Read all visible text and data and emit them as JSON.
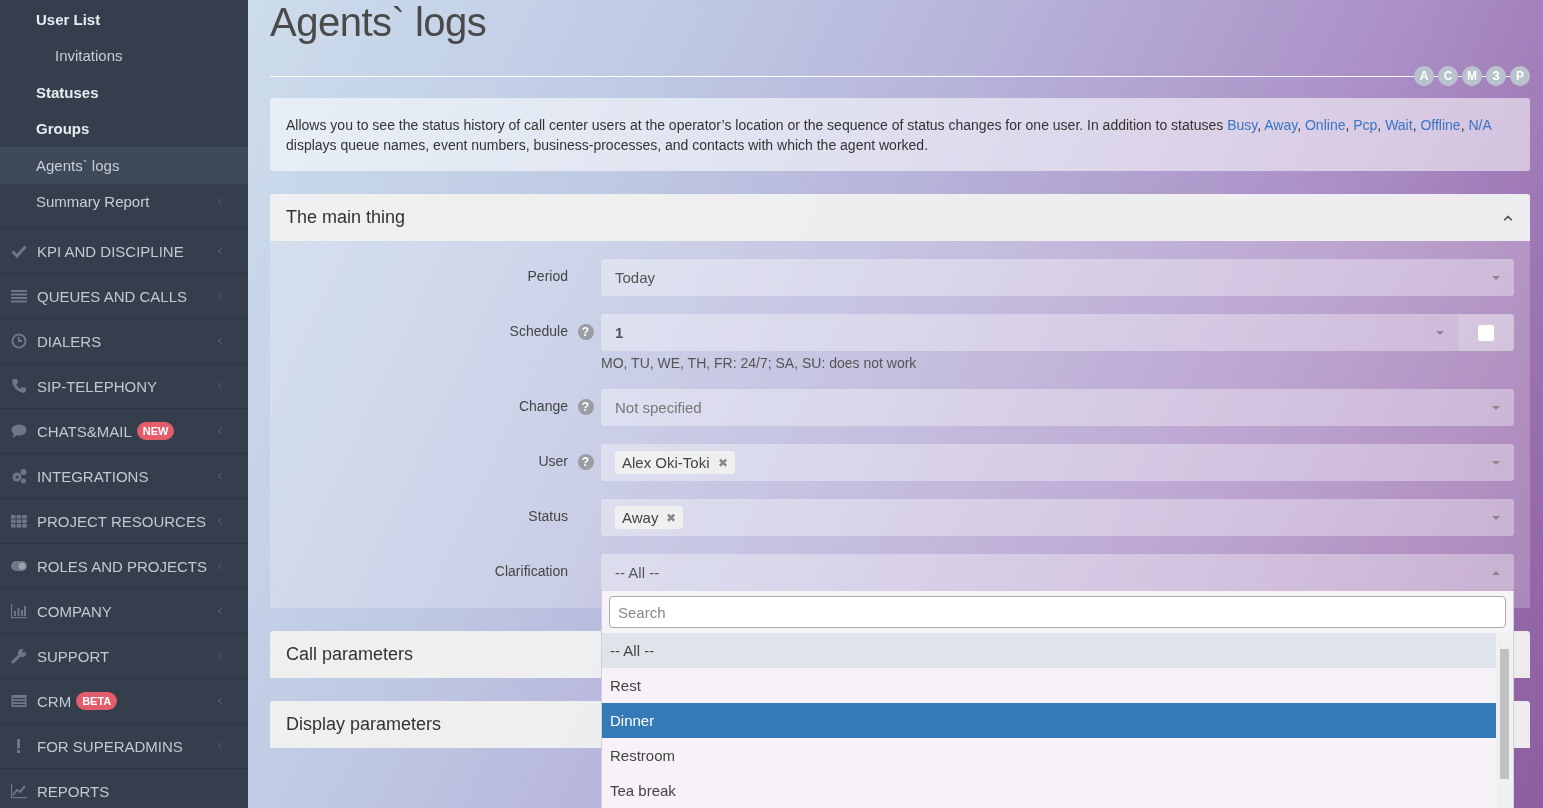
{
  "sidebar": {
    "items": [
      {
        "label": "User List",
        "kind": "link",
        "bold": true,
        "selected": false,
        "has_submenu": false
      },
      {
        "label": "Invitations",
        "kind": "nested",
        "bold": false,
        "selected": false,
        "has_submenu": false
      },
      {
        "label": "Statuses",
        "kind": "link",
        "bold": true,
        "selected": false,
        "has_submenu": false
      },
      {
        "label": "Groups",
        "kind": "link",
        "bold": true,
        "selected": false,
        "has_submenu": false
      },
      {
        "label": "Agents` logs",
        "kind": "link",
        "bold": false,
        "selected": true,
        "has_submenu": false
      },
      {
        "label": "Summary Report",
        "kind": "link",
        "bold": false,
        "selected": false,
        "has_submenu": true
      },
      {
        "label": "KPI AND DISCIPLINE",
        "kind": "section",
        "bold": false,
        "selected": false,
        "has_submenu": true
      },
      {
        "label": "QUEUES AND CALLS",
        "kind": "section",
        "bold": false,
        "selected": false,
        "has_submenu": true
      },
      {
        "label": "DIALERS",
        "kind": "section",
        "bold": false,
        "selected": false,
        "has_submenu": true
      },
      {
        "label": "SIP-TELEPHONY",
        "kind": "section",
        "bold": false,
        "selected": false,
        "has_submenu": true
      },
      {
        "label": "CHATS&MAIL",
        "kind": "section",
        "badge": "NEW",
        "bold": false,
        "selected": false,
        "has_submenu": true
      },
      {
        "label": "INTEGRATIONS",
        "kind": "section",
        "bold": false,
        "selected": false,
        "has_submenu": true
      },
      {
        "label": "PROJECT RESOURCES",
        "kind": "section",
        "bold": false,
        "selected": false,
        "has_submenu": true
      },
      {
        "label": "ROLES AND PROJECTS",
        "kind": "section",
        "bold": false,
        "selected": false,
        "has_submenu": true
      },
      {
        "label": "COMPANY",
        "kind": "section",
        "bold": false,
        "selected": false,
        "has_submenu": true
      },
      {
        "label": "SUPPORT",
        "kind": "section",
        "bold": false,
        "selected": false,
        "has_submenu": true
      },
      {
        "label": "CRM",
        "kind": "section",
        "badge": "BETA",
        "bold": false,
        "selected": false,
        "has_submenu": true
      },
      {
        "label": "FOR SUPERADMINS",
        "kind": "section",
        "bold": false,
        "selected": false,
        "has_submenu": true
      },
      {
        "label": "REPORTS",
        "kind": "section",
        "bold": false,
        "selected": false,
        "has_submenu": false
      }
    ]
  },
  "page": {
    "title": "Agents` logs",
    "steps": [
      "A",
      "C",
      "M",
      "З",
      "P"
    ]
  },
  "info": {
    "segments": [
      {
        "text": "Allows you to see the status history of call center users at the operator’s location or the sequence of status changes for one user. In addition to statuses ",
        "kind": "text"
      },
      {
        "text": "Busy",
        "kind": "link"
      },
      {
        "text": ", ",
        "kind": "text"
      },
      {
        "text": "Away",
        "kind": "link"
      },
      {
        "text": ", ",
        "kind": "text"
      },
      {
        "text": "Online",
        "kind": "link"
      },
      {
        "text": ", ",
        "kind": "text"
      },
      {
        "text": "Pcp",
        "kind": "link"
      },
      {
        "text": ", ",
        "kind": "text"
      },
      {
        "text": "Wait",
        "kind": "link"
      },
      {
        "text": ", ",
        "kind": "text"
      },
      {
        "text": "Offline",
        "kind": "link"
      },
      {
        "text": ", ",
        "kind": "text"
      },
      {
        "text": "N/A",
        "kind": "link"
      },
      {
        "text": " displays queue names, event numbers, business-processes, and contacts with which the agent worked.",
        "kind": "text"
      }
    ]
  },
  "panels": [
    {
      "title": "The main thing",
      "expanded": true,
      "fields": [
        {
          "label": "Period",
          "kind": "select",
          "value": "Today",
          "open": false
        },
        {
          "label": "Schedule",
          "kind": "select",
          "help": "?",
          "value": "1",
          "value_bold": true,
          "hint": "MO, TU, WE, TH, FR: 24/7; SA, SU: does not work",
          "addon_checked": false,
          "open": false
        },
        {
          "label": "Change",
          "kind": "select",
          "help": "?",
          "placeholder": "Not specified",
          "open": false
        },
        {
          "label": "User",
          "kind": "tags",
          "help": "?",
          "tags": [
            {
              "text": "Alex Oki-Toki",
              "remove": "✖"
            }
          ],
          "open": false
        },
        {
          "label": "Status",
          "kind": "tags",
          "tags": [
            {
              "text": "Away",
              "remove": "✖"
            }
          ],
          "open": false
        },
        {
          "label": "Clarification",
          "kind": "select",
          "value": "-- All --",
          "open": true,
          "dropdown": {
            "search_placeholder": "Search",
            "options": [
              {
                "label": "-- All --",
                "current": true,
                "selected": false
              },
              {
                "label": "Rest",
                "current": false,
                "selected": false
              },
              {
                "label": "Dinner",
                "current": false,
                "selected": true
              },
              {
                "label": "Restroom",
                "current": false,
                "selected": false
              },
              {
                "label": "Tea break",
                "current": false,
                "selected": false
              }
            ]
          }
        }
      ]
    },
    {
      "title": "Call parameters",
      "expanded": false
    },
    {
      "title": "Display parameters",
      "expanded": false
    }
  ]
}
